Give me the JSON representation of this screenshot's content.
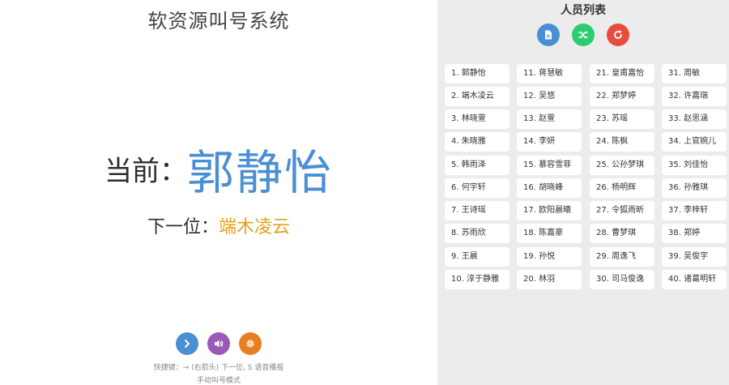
{
  "app_title": "软资源叫号系统",
  "current": {
    "label": "当前：",
    "name": "郭静怡"
  },
  "next": {
    "label": "下一位：",
    "name": "端木凌云"
  },
  "controls": [
    {
      "name": "next-button",
      "icon": "chevron-right-icon",
      "color": "#4a8fd4"
    },
    {
      "name": "voice-button",
      "icon": "speaker-icon",
      "color": "#9b59b6"
    },
    {
      "name": "settings-button",
      "icon": "gear-icon",
      "color": "#e67e22"
    }
  ],
  "hint": "快捷键：→ (右箭头) 下一位, S 语音播报",
  "mode": "手动叫号模式",
  "list_title": "人员列表",
  "list_buttons": [
    {
      "name": "import-button",
      "icon": "file-icon",
      "color": "#4a8fd4"
    },
    {
      "name": "shuffle-button",
      "icon": "shuffle-icon",
      "color": "#2ecc71"
    },
    {
      "name": "reset-button",
      "icon": "refresh-icon",
      "color": "#e74c3c"
    }
  ],
  "people": [
    "1. 郭静怡",
    "2. 端木凌云",
    "3. 林晓萱",
    "4. 朱晓雅",
    "5. 韩雨泽",
    "6. 何宇轩",
    "7. 王诗瑶",
    "8. 苏雨欣",
    "9. 王晨",
    "10. 淳于静雅",
    "11. 蒋慧敏",
    "12. 吴悠",
    "13. 赵萱",
    "14. 李妍",
    "15. 慕容雪菲",
    "16. 胡晓峰",
    "17. 欧阳晨曦",
    "18. 陈嘉豪",
    "19. 孙悦",
    "20. 林羽",
    "21. 皇甫嘉怡",
    "22. 郑梦婷",
    "23. 苏瑶",
    "24. 陈枫",
    "25. 公孙梦琪",
    "26. 杨明辉",
    "27. 令狐雨昕",
    "28. 曹梦琪",
    "29. 周逸飞",
    "30. 司马俊逸",
    "31. 周敏",
    "32. 许嘉瑞",
    "33. 赵思涵",
    "34. 上官婉儿",
    "35. 刘佳怡",
    "36. 孙雅琪",
    "37. 李梓轩",
    "38. 郑婷",
    "39. 吴俊宇",
    "40. 诸葛明轩"
  ]
}
